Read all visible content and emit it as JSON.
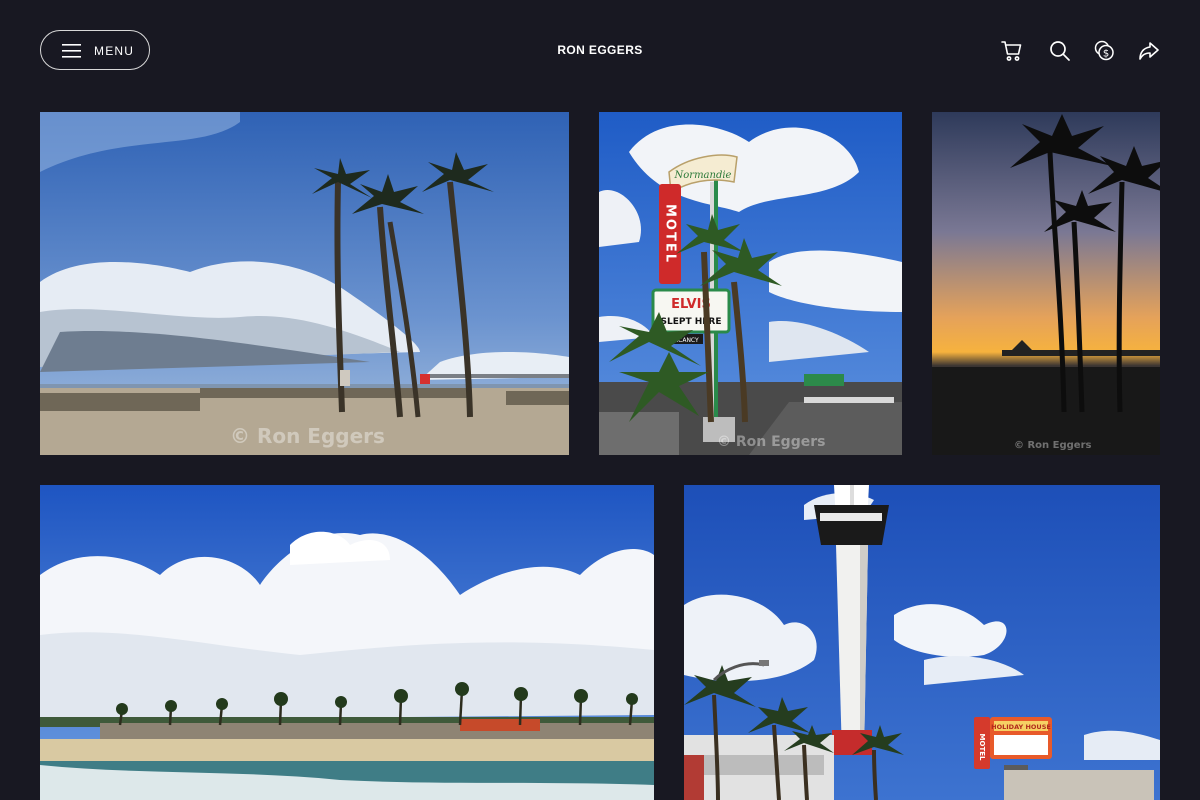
{
  "header": {
    "menu_label": "MENU",
    "site_title": "RON EGGERS",
    "icons": [
      "cart-icon",
      "search-icon",
      "pricing-icon",
      "share-icon"
    ]
  },
  "gallery": {
    "watermark": "© Ron Eggers",
    "photos": [
      {
        "subject": "beach-palms",
        "signs": []
      },
      {
        "subject": "motel-sign",
        "signs": [
          "Normandie",
          "MOTEL",
          "ELVIS",
          "SLEPT HERE",
          "NO VACANCY"
        ]
      },
      {
        "subject": "palm-sunset",
        "signs": []
      },
      {
        "subject": "beach-clouds",
        "signs": []
      },
      {
        "subject": "stratosphere-tower",
        "signs": [
          "MOTEL",
          "HOLIDAY HOUSE"
        ]
      }
    ]
  },
  "colors": {
    "background": "#181822",
    "text": "#ffffff",
    "sky_blue": "#2f64c4",
    "sunset_orange": "#f0a24a"
  }
}
